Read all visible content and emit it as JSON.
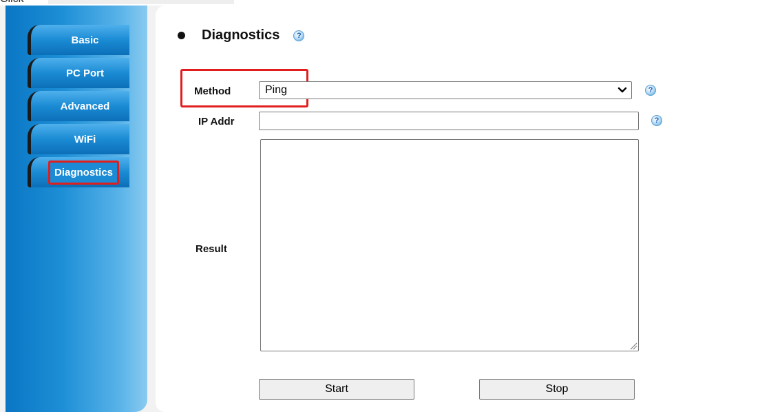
{
  "top": {
    "clipped_label": "Click"
  },
  "sidebar": {
    "items": [
      {
        "label": "Basic"
      },
      {
        "label": "PC Port"
      },
      {
        "label": "Advanced"
      },
      {
        "label": "WiFi"
      },
      {
        "label": "Diagnostics",
        "active": true
      }
    ]
  },
  "main": {
    "title": "Diagnostics",
    "method": {
      "label": "Method",
      "value": "Ping",
      "options": [
        "Ping"
      ]
    },
    "ip_addr": {
      "label": "IP Addr",
      "value": "",
      "placeholder": ""
    },
    "result": {
      "label": "Result",
      "value": ""
    },
    "buttons": {
      "start": "Start",
      "stop": "Stop"
    }
  },
  "colors": {
    "sidebar": "#1d8fd6",
    "highlight": "#e01e1e",
    "panel": "#ffffff"
  },
  "icons": {
    "help": "help-icon",
    "dropdown": "chevron-down-icon",
    "resize": "resize-grip-icon",
    "bullet": "bullet-icon"
  }
}
